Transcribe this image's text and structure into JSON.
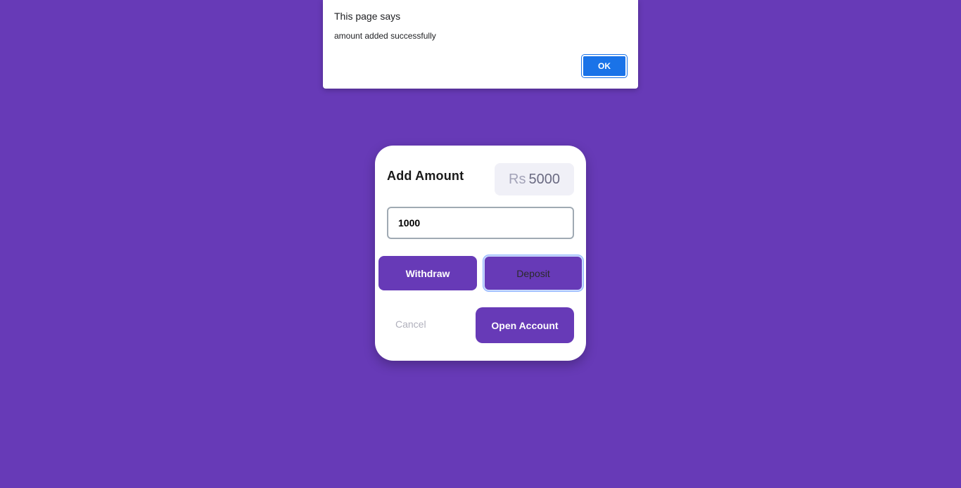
{
  "alert": {
    "title": "This page says",
    "message": "amount added successfully",
    "ok_label": "OK"
  },
  "card": {
    "title": "Add Amount",
    "balance": {
      "currency": "Rs",
      "value": "5000"
    },
    "amount_input": {
      "value": "1000"
    },
    "withdraw_label": "Withdraw",
    "deposit_label": "Deposit",
    "cancel_label": "Cancel",
    "open_account_label": "Open Account"
  },
  "colors": {
    "background": "#673ab7",
    "button": "#673ab7",
    "alert_ok": "#1a73e8"
  }
}
